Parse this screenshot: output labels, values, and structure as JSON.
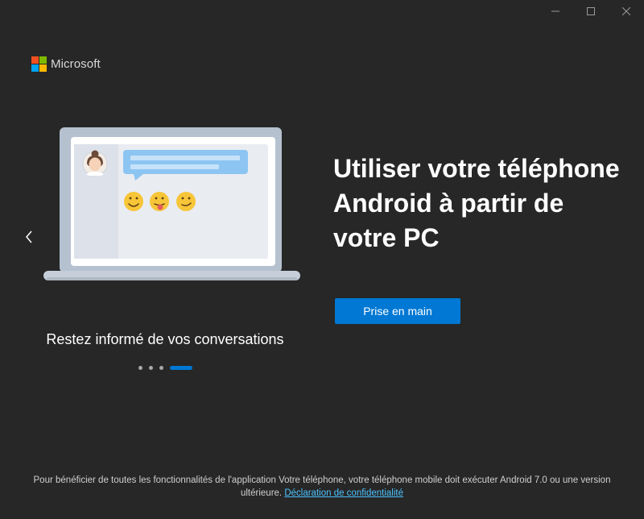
{
  "window": {
    "controls": [
      {
        "name": "minimize-icon",
        "glyph": "minimize"
      },
      {
        "name": "maximize-icon",
        "glyph": "maximize"
      },
      {
        "name": "close-icon",
        "glyph": "close"
      }
    ]
  },
  "brand": {
    "name": "Microsoft",
    "logo_colors": [
      "#f25022",
      "#7fba00",
      "#00a4ef",
      "#ffb900"
    ]
  },
  "carousel": {
    "prev_icon": "chevron-left-icon",
    "caption": "Restez informé de vos conversations",
    "total_slides": 4,
    "active_slide": 4,
    "illustration": {
      "emoji_icons": [
        "smile-emoji-icon",
        "tongue-emoji-icon",
        "smirk-emoji-icon"
      ]
    }
  },
  "hero": {
    "headline": "Utiliser votre téléphone Android à partir de votre PC",
    "cta_label": "Prise en main"
  },
  "footer": {
    "text": "Pour bénéficier de toutes les fonctionnalités de l'application Votre téléphone, votre téléphone mobile doit exécuter Android 7.0 ou une version ultérieure.",
    "link_label": "Déclaration de confidentialité"
  },
  "colors": {
    "background": "#272727",
    "accent": "#0078d4",
    "link": "#4cc2ff",
    "text": "#ffffff"
  }
}
